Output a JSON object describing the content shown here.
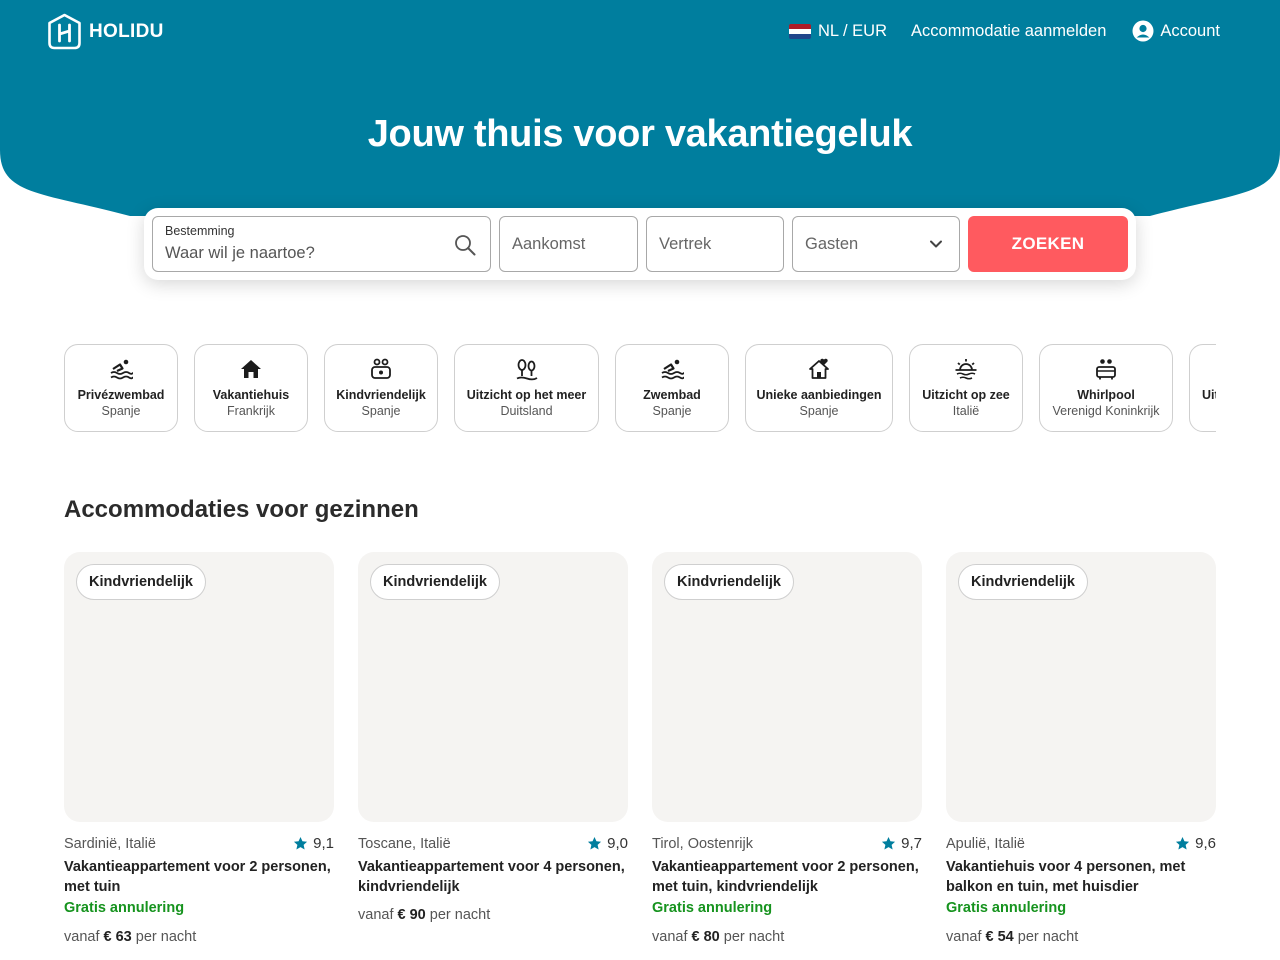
{
  "colors": {
    "brand": "#007e9e",
    "cta": "#ff5a5f",
    "success": "#16931e",
    "card_bg": "#f5f4f2",
    "rating_star": "#007e9e"
  },
  "header": {
    "logo_text": "HOLIDU",
    "lang_currency": "NL / EUR",
    "list_property": "Accommodatie aanmelden",
    "account": "Account"
  },
  "hero": {
    "title": "Jouw thuis voor vakantiegeluk"
  },
  "search": {
    "destination_label": "Bestemming",
    "destination_placeholder": "Waar wil je naartoe?",
    "arrival_placeholder": "Aankomst",
    "departure_placeholder": "Vertrek",
    "guests_placeholder": "Gasten",
    "button_label": "ZOEKEN"
  },
  "categories": [
    {
      "title": "Privézwembad",
      "subtitle": "Spanje",
      "icon": "pool-icon"
    },
    {
      "title": "Vakantiehuis",
      "subtitle": "Frankrijk",
      "icon": "house-icon"
    },
    {
      "title": "Kindvriendelijk",
      "subtitle": "Spanje",
      "icon": "family-icon"
    },
    {
      "title": "Uitzicht op het meer",
      "subtitle": "Duitsland",
      "icon": "lake-view-icon"
    },
    {
      "title": "Zwembad",
      "subtitle": "Spanje",
      "icon": "pool-icon"
    },
    {
      "title": "Unieke aanbiedingen",
      "subtitle": "Spanje",
      "icon": "heart-house-icon"
    },
    {
      "title": "Uitzicht op zee",
      "subtitle": "Italië",
      "icon": "sea-view-icon"
    },
    {
      "title": "Whirlpool",
      "subtitle": "Verenigd Koninkrijk",
      "icon": "hot-tub-icon"
    },
    {
      "title": "Uit",
      "subtitle": "",
      "icon": ""
    }
  ],
  "section": {
    "title": "Accommodaties voor gezinnen"
  },
  "cards": [
    {
      "badge": "Kindvriendelijk",
      "location": "Sardinië, Italië",
      "rating": "9,1",
      "title": "Vakantieappartement voor 2 personen, met tuin",
      "cancellation": "Gratis annulering",
      "price_prefix": "vanaf",
      "price": "€ 63",
      "price_suffix": "per nacht"
    },
    {
      "badge": "Kindvriendelijk",
      "location": "Toscane, Italië",
      "rating": "9,0",
      "title": "Vakantieappartement voor 4 personen, kindvriendelijk",
      "cancellation": "",
      "price_prefix": "vanaf",
      "price": "€ 90",
      "price_suffix": "per nacht"
    },
    {
      "badge": "Kindvriendelijk",
      "location": "Tirol, Oostenrijk",
      "rating": "9,7",
      "title": "Vakantieappartement voor 2 personen, met tuin, kindvriendelijk",
      "cancellation": "Gratis annulering",
      "price_prefix": "vanaf",
      "price": "€ 80",
      "price_suffix": "per nacht"
    },
    {
      "badge": "Kindvriendelijk",
      "location": "Apulië, Italië",
      "rating": "9,6",
      "title": "Vakantiehuis voor 4 personen, met balkon en tuin, met huisdier",
      "cancellation": "Gratis annulering",
      "price_prefix": "vanaf",
      "price": "€ 54",
      "price_suffix": "per nacht"
    }
  ]
}
